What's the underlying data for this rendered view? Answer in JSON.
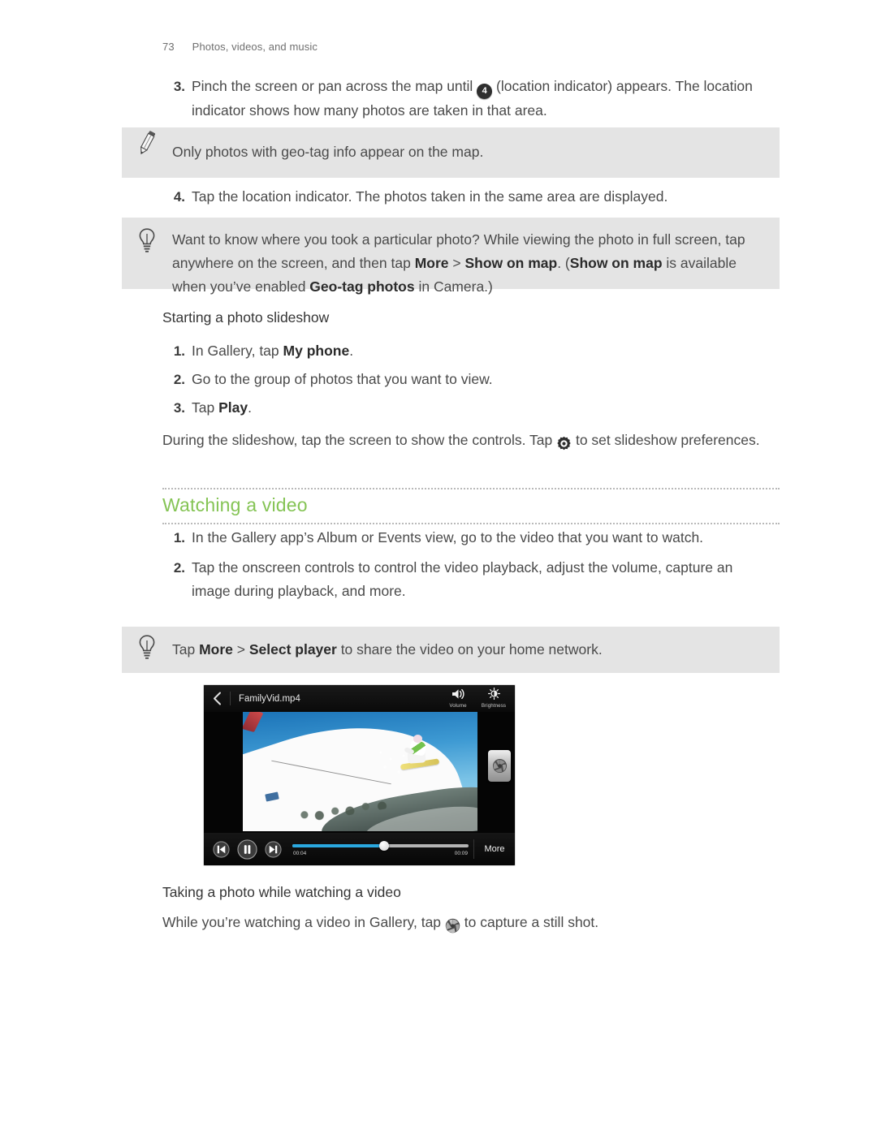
{
  "header": {
    "page_number": "73",
    "chapter": "Photos, videos, and music"
  },
  "steps_map": {
    "items": [
      {
        "num": "3.",
        "parts": [
          {
            "t": "Pinch the screen or pan across the map until ",
            "b": false
          },
          {
            "t": "badge",
            "b": false,
            "icon": "location-count-badge",
            "value": "4"
          },
          {
            "t": " (location indicator) appears. The location indicator shows how many photos are taken in that area.",
            "b": false
          }
        ]
      }
    ]
  },
  "note_box": {
    "icon": "pencil-icon",
    "text": "Only photos with geo-tag info appear on the map."
  },
  "step4": {
    "num": "4.",
    "text": "Tap the location indicator. The photos taken in the same area are displayed."
  },
  "tip_box_1": {
    "icon": "lightbulb-icon",
    "segments": [
      {
        "t": "Want to know where you took a particular photo? While viewing the photo in full screen, tap anywhere on the screen, and then tap ",
        "b": false
      },
      {
        "t": "More",
        "b": true
      },
      {
        "t": " > ",
        "b": false
      },
      {
        "t": "Show on map",
        "b": true
      },
      {
        "t": ". (",
        "b": false
      },
      {
        "t": "Show on map",
        "b": true
      },
      {
        "t": " is available when you’ve enabled ",
        "b": false
      },
      {
        "t": "Geo-tag photos",
        "b": true
      },
      {
        "t": " in Camera.)",
        "b": false
      }
    ]
  },
  "slideshow": {
    "subheading": "Starting a photo slideshow",
    "steps": [
      {
        "num": "1.",
        "segments": [
          {
            "t": "In Gallery, tap ",
            "b": false
          },
          {
            "t": "My phone",
            "b": true
          },
          {
            "t": ".",
            "b": false
          }
        ]
      },
      {
        "num": "2.",
        "segments": [
          {
            "t": "Go to the group of photos that you want to view.",
            "b": false
          }
        ]
      },
      {
        "num": "3.",
        "segments": [
          {
            "t": "Tap ",
            "b": false
          },
          {
            "t": "Play",
            "b": true
          },
          {
            "t": ".",
            "b": false
          }
        ]
      }
    ],
    "footnote": {
      "before": "During the slideshow, tap the screen to show the controls. Tap ",
      "icon": "gear-icon",
      "after": " to set slideshow preferences."
    }
  },
  "section_watching": {
    "title": "Watching a video",
    "accent_color": "#85c455",
    "steps": [
      {
        "num": "1.",
        "text": "In the Gallery app’s Album or Events view, go to the video that you want to watch."
      },
      {
        "num": "2.",
        "text": "Tap the onscreen controls to control the video playback, adjust the volume, capture an image during playback, and more."
      }
    ]
  },
  "tip_box_2": {
    "icon": "lightbulb-icon",
    "segments": [
      {
        "t": "Tap ",
        "b": false
      },
      {
        "t": "More",
        "b": true
      },
      {
        "t": " > ",
        "b": false
      },
      {
        "t": "Select player",
        "b": true
      },
      {
        "t": " to share the video on your home network.",
        "b": false
      }
    ]
  },
  "video_player": {
    "back_icon": "back-chevron-icon",
    "title": "FamilyVid.mp4",
    "volume": {
      "icon": "volume-icon",
      "label": "Volume"
    },
    "brightness": {
      "icon": "brightness-icon",
      "label": "Brightness"
    },
    "capture_icon": "camera-shutter-icon",
    "controls": {
      "previous_icon": "previous-track-icon",
      "pause_icon": "pause-icon",
      "next_icon": "next-track-icon",
      "elapsed_time": "00:04",
      "total_time": "00:09",
      "progress_percent": 52,
      "progress_color": "#2aa8df",
      "more_label": "More"
    }
  },
  "taking_photo": {
    "subheading": "Taking a photo while watching a video",
    "before": "While you’re watching a video in Gallery, tap ",
    "icon": "camera-shutter-icon",
    "after": " to capture a still shot."
  }
}
